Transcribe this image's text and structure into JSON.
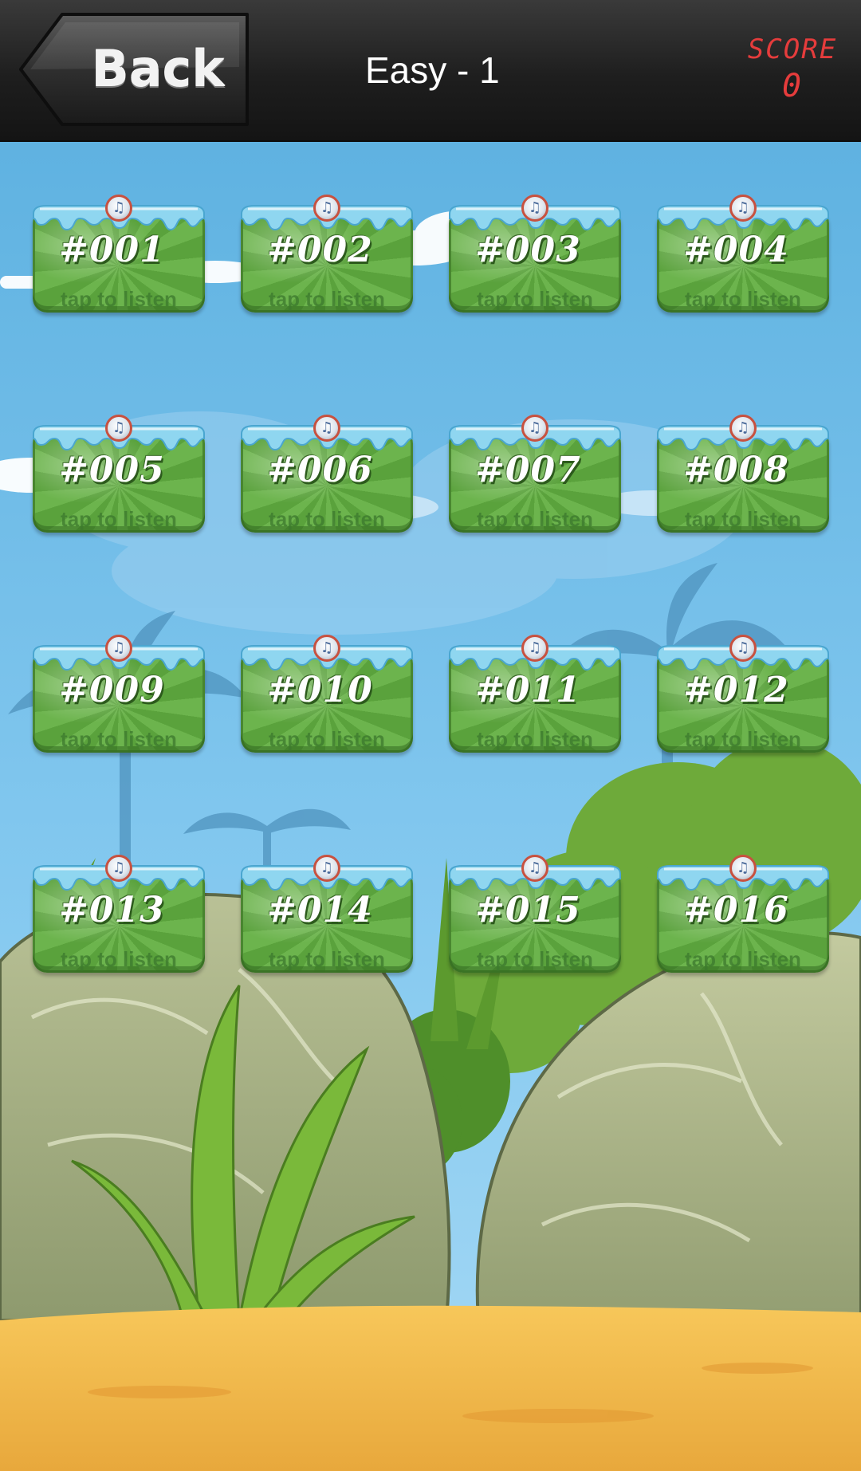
{
  "header": {
    "back_label": "Back",
    "level_title": "Easy - 1",
    "score_label": "SCORE",
    "score_value": "0"
  },
  "tiles": [
    {
      "label": "#001",
      "hint": "tap to listen"
    },
    {
      "label": "#002",
      "hint": "tap to listen"
    },
    {
      "label": "#003",
      "hint": "tap to listen"
    },
    {
      "label": "#004",
      "hint": "tap to listen"
    },
    {
      "label": "#005",
      "hint": "tap to listen"
    },
    {
      "label": "#006",
      "hint": "tap to listen"
    },
    {
      "label": "#007",
      "hint": "tap to listen"
    },
    {
      "label": "#008",
      "hint": "tap to listen"
    },
    {
      "label": "#009",
      "hint": "tap to listen"
    },
    {
      "label": "#010",
      "hint": "tap to listen"
    },
    {
      "label": "#011",
      "hint": "tap to listen"
    },
    {
      "label": "#012",
      "hint": "tap to listen"
    },
    {
      "label": "#013",
      "hint": "tap to listen"
    },
    {
      "label": "#014",
      "hint": "tap to listen"
    },
    {
      "label": "#015",
      "hint": "tap to listen"
    },
    {
      "label": "#016",
      "hint": "tap to listen"
    }
  ],
  "colors": {
    "header_bg": "#1e1e1e",
    "score_red": "#e53c3c",
    "sky": "#6fbbe6",
    "tile_green": "#63aa45",
    "rock": "#a8b287",
    "sand": "#f0b64a"
  },
  "icons": {
    "tile_badge": "music-note-icon"
  }
}
